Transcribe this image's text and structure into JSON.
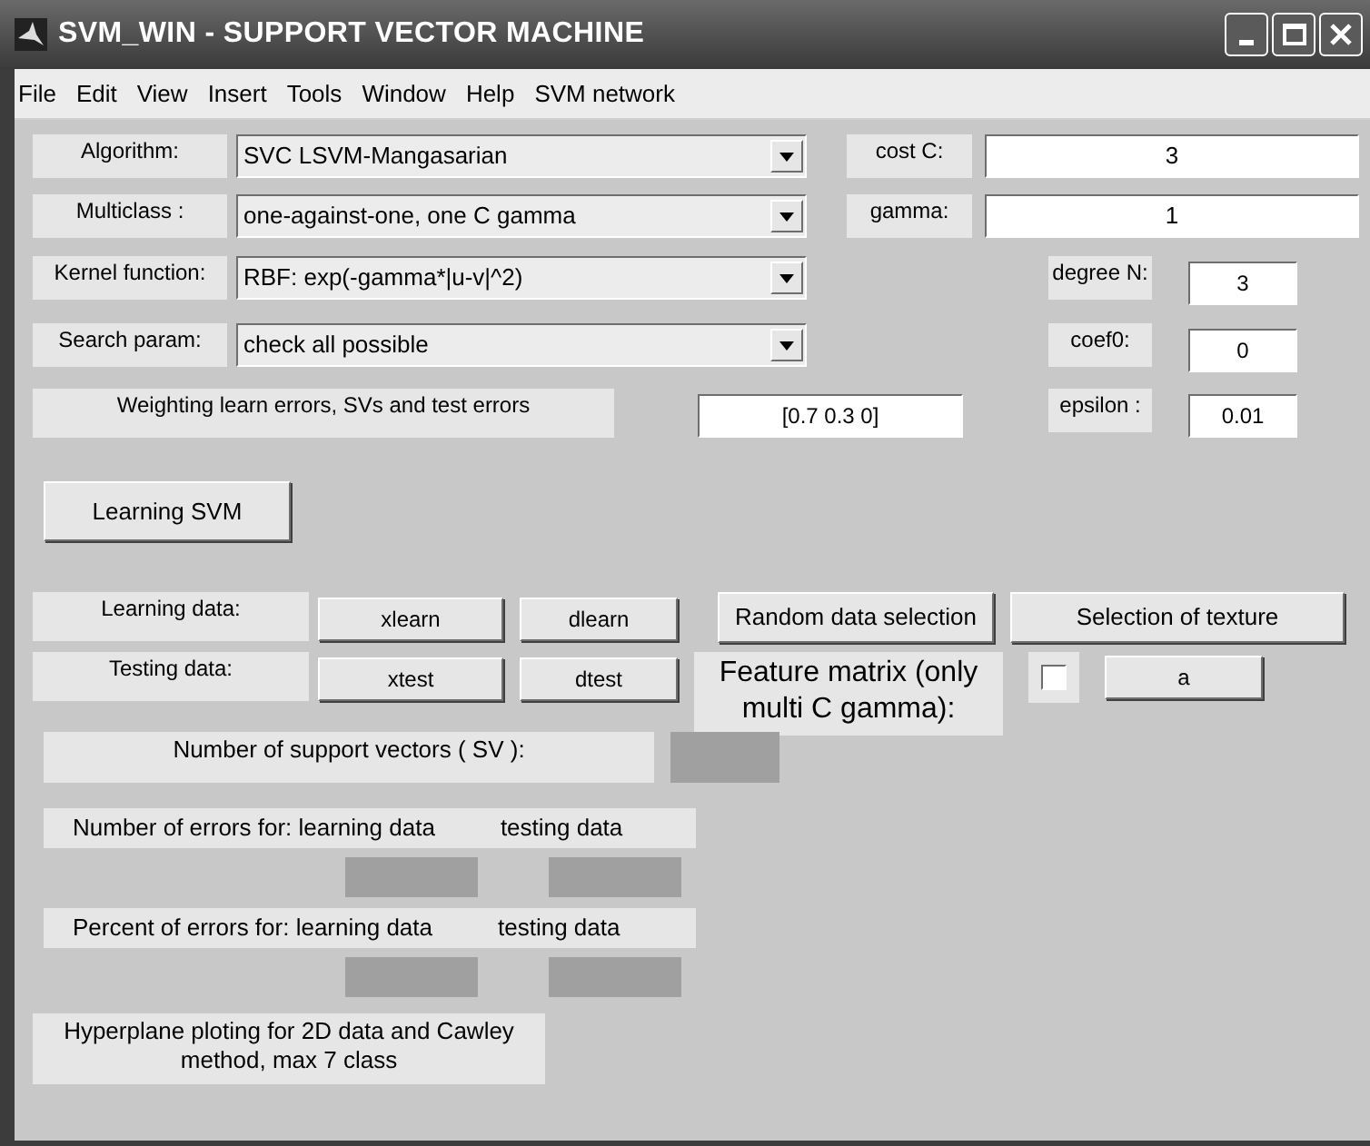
{
  "window": {
    "title": "SVM_WIN - SUPPORT VECTOR MACHINE"
  },
  "menu": [
    "File",
    "Edit",
    "View",
    "Insert",
    "Tools",
    "Window",
    "Help",
    "SVM network"
  ],
  "settings": [
    {
      "label": "Algorithm:",
      "value": "SVC LSVM-Mangasarian"
    },
    {
      "label": "Multiclass :",
      "value": "one-against-one, one C gamma"
    },
    {
      "label": "Kernel function:",
      "value": "RBF: exp(-gamma*|u-v|^2)"
    },
    {
      "label": "Search param:",
      "value": "check all possible"
    }
  ],
  "parameters": [
    {
      "label": "cost C:",
      "value": "3"
    },
    {
      "label": "gamma:",
      "value": "1"
    },
    {
      "label": "degree N:",
      "value": "3"
    },
    {
      "label": "coef0:",
      "value": "0"
    },
    {
      "label": "epsilon :",
      "value": "0.01"
    }
  ],
  "weighting": {
    "label": "Weighting learn errors, SVs and test errors",
    "value": "[0.7 0.3 0]"
  },
  "learn_button": "Learning SVM",
  "data_rows": [
    {
      "label": "Learning data:",
      "x_button": "xlearn",
      "d_button": "dlearn"
    },
    {
      "label": "Testing data:",
      "x_button": "xtest",
      "d_button": "dtest"
    }
  ],
  "random_button": "Random data selection",
  "texture_button": "Selection of texture",
  "feature_matrix": {
    "label": "Feature matrix (only multi C gamma):",
    "checked": false,
    "value": "a"
  },
  "sv_label": "Number of support vectors ( SV ):",
  "error_rows": [
    {
      "label": "Number of errors for: learning data",
      "testing": "testing data"
    },
    {
      "label": "Percent of errors for: learning data",
      "testing": "testing data"
    }
  ],
  "hyperplane_note": "Hyperplane ploting for 2D data and Cawley method, max 7 class"
}
